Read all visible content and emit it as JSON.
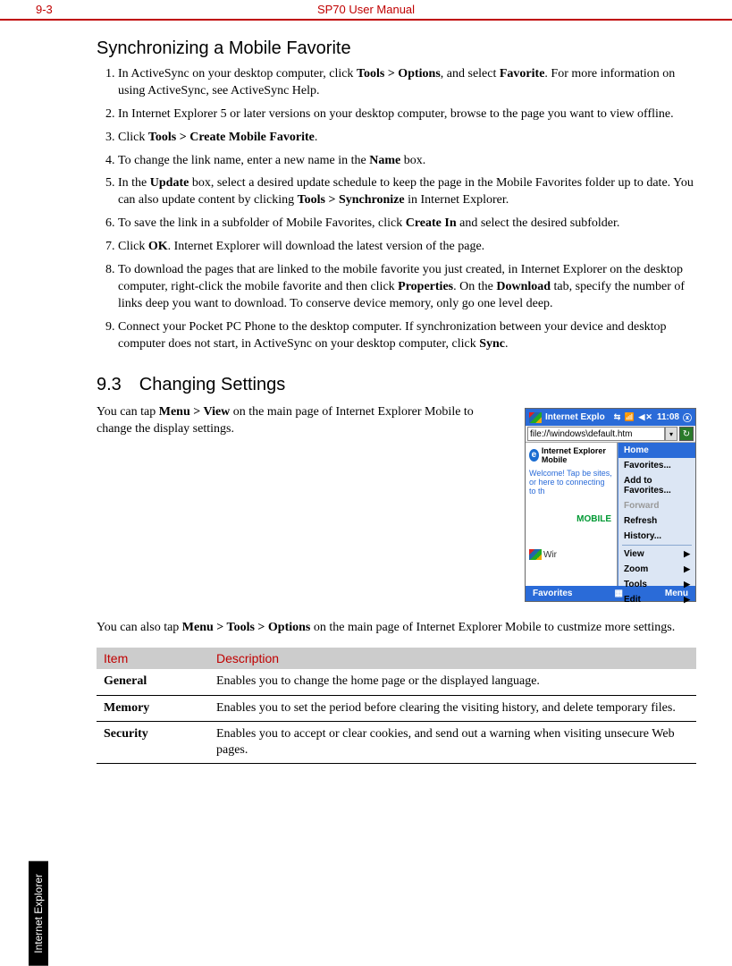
{
  "header": {
    "page_num": "9-3",
    "title": "SP70 User Manual"
  },
  "side_tab": "Internet Explorer",
  "section_sync": {
    "heading": "Synchronizing a Mobile Favorite",
    "steps": [
      {
        "pre": "In ActiveSync on your desktop computer, click ",
        "b1": "Tools > Options",
        "mid": ", and select ",
        "b2": "Favorite",
        "post": ". For more information on using ActiveSync, see ActiveSync Help."
      },
      {
        "text": "In Internet Explorer 5 or later versions on your desktop computer, browse to the page you want to view offline."
      },
      {
        "pre": "Click ",
        "b1": "Tools > Create Mobile Favorite",
        "post": "."
      },
      {
        "pre": "To change the link name, enter a new name in the ",
        "b1": "Name",
        "post": " box."
      },
      {
        "pre": "In the ",
        "b1": "Update",
        "mid": " box, select a desired update schedule to keep the page in the Mobile Favorites folder up to date. You can also update content by clicking ",
        "b2": "Tools > Synchronize",
        "post": " in Internet Explorer."
      },
      {
        "pre": "To save the link in a subfolder of Mobile Favorites, click ",
        "b1": "Create In",
        "post": " and select the desired subfolder."
      },
      {
        "pre": "Click ",
        "b1": "OK",
        "post": ". Internet Explorer will download the latest version of the page."
      },
      {
        "pre": "To download the pages that are linked to the mobile favorite you just created, in Internet Explorer on the desktop computer, right-click the mobile favorite and then click ",
        "b1": "Properties",
        "mid": ". On the ",
        "b2": "Download",
        "post": " tab, specify the number of links deep you want to download. To conserve device memory, only go one level deep."
      },
      {
        "pre": "Connect your Pocket PC Phone to the desktop computer. If synchronization between your device and desktop computer does not start, in ActiveSync on your desktop computer, click ",
        "b1": "Sync",
        "post": "."
      }
    ]
  },
  "section_93": {
    "heading": "9.3 Changing Settings",
    "para1_pre": "You can tap ",
    "para1_b": "Menu > View",
    "para1_post": " on the main page of Internet Explorer Mobile to change the display settings.",
    "para2_pre": "You can also tap ",
    "para2_b": "Menu > Tools > Options",
    "para2_post": " on the main page of Internet Explorer Mobile to custmize more settings."
  },
  "mock": {
    "titlebar": "Internet Explo",
    "time": "11:08",
    "address": "file://\\windows\\default.htm",
    "brand": "Internet Explorer Mobile",
    "welcome": "Welcome! Tap be sites, or here to connecting to th",
    "mobile_label": "MOBILE",
    "win_label": "Wir",
    "menu": {
      "home": "Home",
      "favorites": "Favorites...",
      "addfav": "Add to Favorites...",
      "forward": "Forward",
      "refresh": "Refresh",
      "history": "History...",
      "view": "View",
      "zoom": "Zoom",
      "tools": "Tools",
      "edit": "Edit"
    },
    "bottom_left": "Favorites",
    "bottom_right": "Menu"
  },
  "table": {
    "h_item": "Item",
    "h_desc": "Description",
    "rows": [
      {
        "item": "General",
        "desc": "Enables you to change the home page or the displayed language."
      },
      {
        "item": "Memory",
        "desc": "Enables you to set the period before clearing the visiting history, and delete temporary files."
      },
      {
        "item": "Security",
        "desc": "Enables you to accept or clear cookies, and send out a warning when visiting unsecure Web pages."
      }
    ]
  }
}
